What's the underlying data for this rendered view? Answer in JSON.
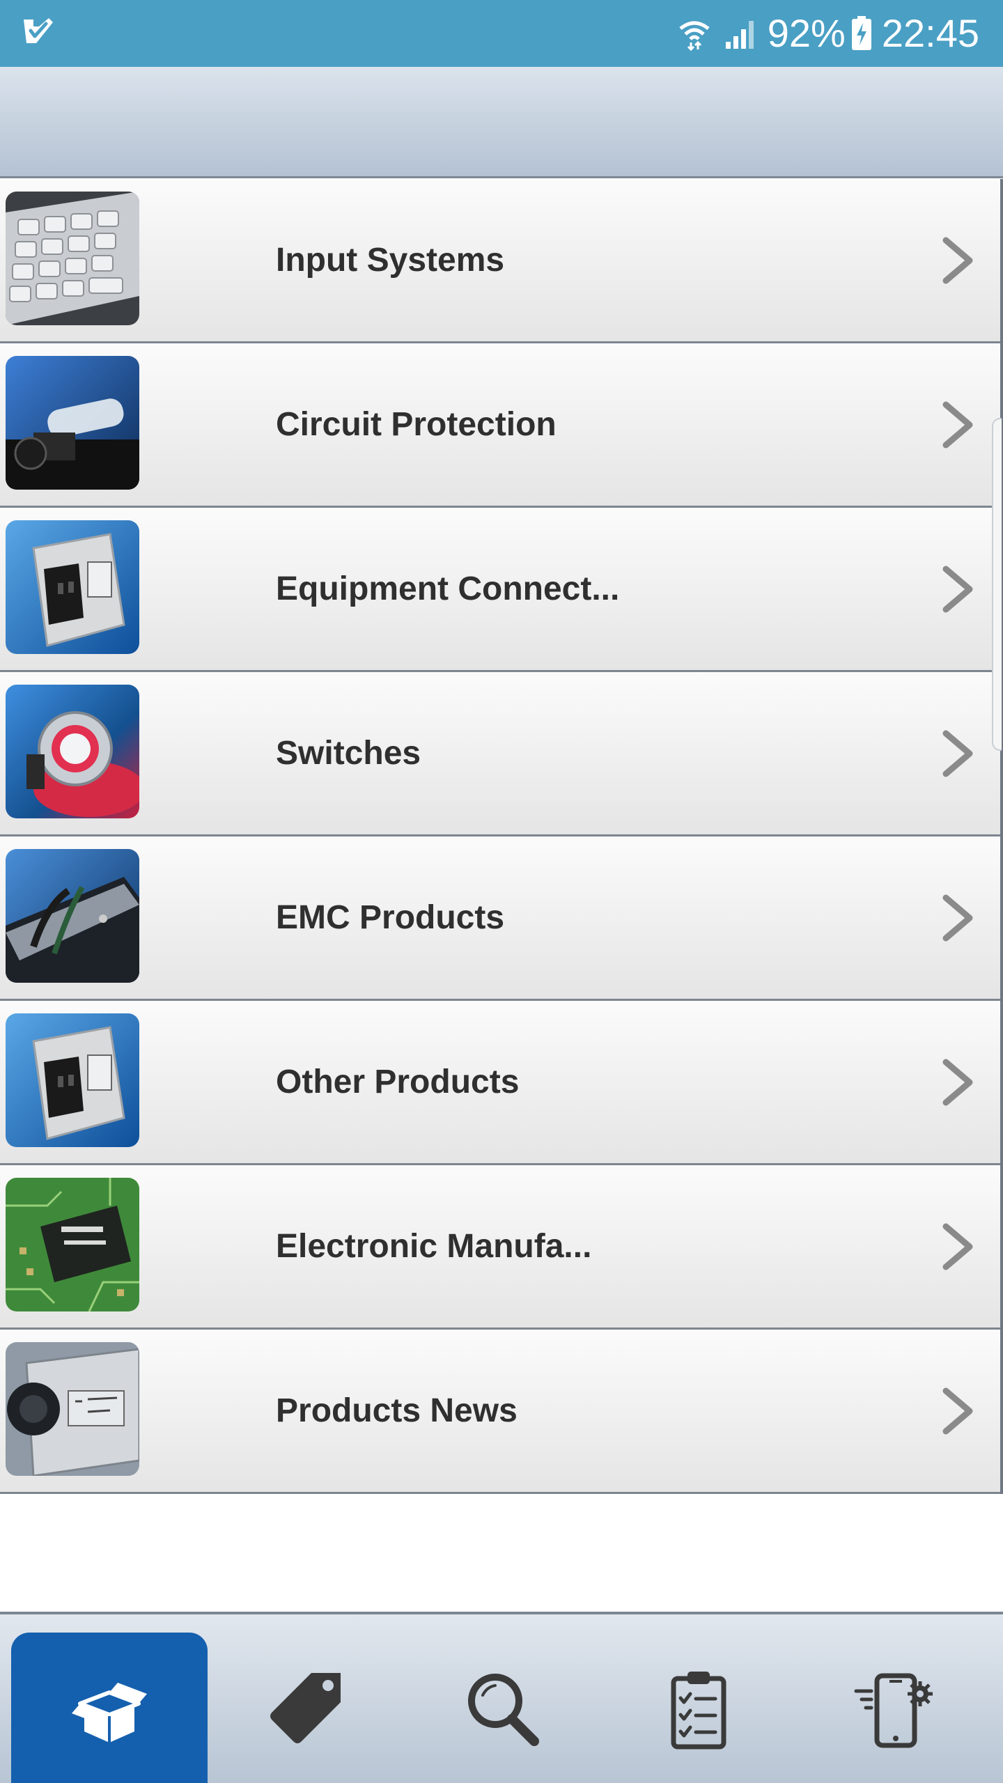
{
  "status_bar": {
    "battery_percent": "92%",
    "time": "22:45"
  },
  "header": {
    "title": ""
  },
  "categories": [
    {
      "label": "Input Systems",
      "thumb_icon": "keypad-thumbnail"
    },
    {
      "label": "Circuit Protection",
      "thumb_icon": "fuse-thumbnail"
    },
    {
      "label": "Equipment Connect...",
      "thumb_icon": "power-inlet-thumbnail"
    },
    {
      "label": "Switches",
      "thumb_icon": "pushbutton-thumbnail"
    },
    {
      "label": "EMC Products",
      "thumb_icon": "emc-filter-thumbnail"
    },
    {
      "label": "Other Products",
      "thumb_icon": "power-inlet-thumbnail"
    },
    {
      "label": "Electronic Manufa...",
      "thumb_icon": "circuit-board-thumbnail"
    },
    {
      "label": "Products News",
      "thumb_icon": "fuse-holder-thumbnail"
    }
  ],
  "bottom_nav": {
    "tabs": [
      {
        "icon": "box-icon",
        "active": true
      },
      {
        "icon": "tag-icon",
        "active": false
      },
      {
        "icon": "search-icon",
        "active": false
      },
      {
        "icon": "clipboard-checklist-icon",
        "active": false
      },
      {
        "icon": "mobile-settings-icon",
        "active": false
      }
    ]
  },
  "colors": {
    "status_bar": "#4a9fc4",
    "active_tab": "#1560ae",
    "icon_dark": "#3a3a3a",
    "chevron": "#8a8a8a"
  }
}
